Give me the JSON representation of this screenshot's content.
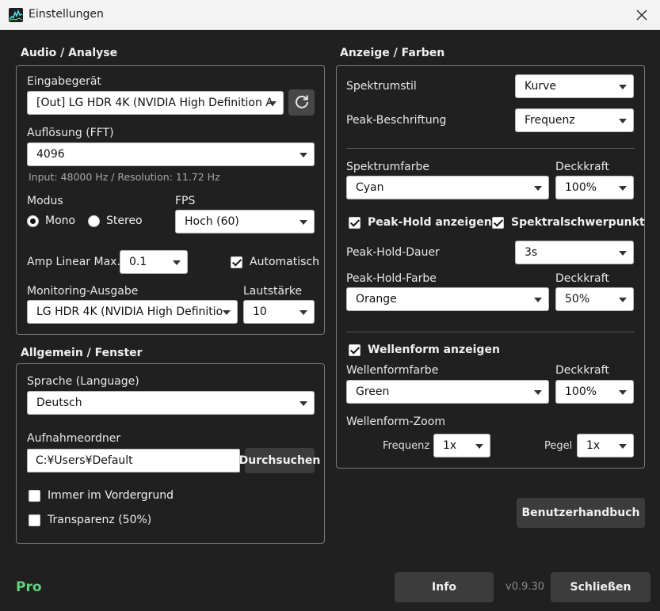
{
  "window": {
    "title": "Einstellungen",
    "icon": "spectrum-app-icon",
    "close_icon": "close-icon"
  },
  "audio": {
    "section_title": "Audio / Analyse",
    "input_device_label": "Eingabegerät",
    "input_device_value": "[Out] LG HDR 4K (NVIDIA High Definition A",
    "refresh_icon": "refresh-icon",
    "fft_label": "Auflösung (FFT)",
    "fft_value": "4096",
    "info_text": "Input: 48000 Hz / Resolution: 11.72 Hz",
    "mode_label": "Modus",
    "mode_mono": "Mono",
    "mode_stereo": "Stereo",
    "mode_selected": "Mono",
    "fps_label": "FPS",
    "fps_value": "Hoch (60)",
    "amp_label": "Amp Linear Max.",
    "amp_value": "0.1",
    "auto_label": "Automatisch",
    "auto_checked": true,
    "monitor_label": "Monitoring-Ausgabe",
    "monitor_value": "LG HDR 4K (NVIDIA High Definitio",
    "volume_label": "Lautstärke",
    "volume_value": "10"
  },
  "general": {
    "section_title": "Allgemein / Fenster",
    "language_label": "Sprache (Language)",
    "language_value": "Deutsch",
    "folder_label": "Aufnahmeordner",
    "folder_value": "C:¥Users¥Default",
    "browse_label": "Durchsuchen",
    "always_on_top_label": "Immer im Vordergrund",
    "always_on_top_checked": false,
    "transparency_label": "Transparenz (50%)",
    "transparency_checked": false
  },
  "display": {
    "section_title": "Anzeige / Farben",
    "spectrum_style_label": "Spektrumstil",
    "spectrum_style_value": "Kurve",
    "peak_label_label": "Peak-Beschriftung",
    "peak_label_value": "Frequenz",
    "spectrum_color_label": "Spektrumfarbe",
    "spectrum_color_value": "Cyan",
    "opacity_label": "Deckkraft",
    "spectrum_opacity_value": "100%",
    "peak_hold_label": "Peak-Hold anzeigen",
    "peak_hold_checked": true,
    "centroid_label": "Spektralschwerpunkt",
    "centroid_checked": true,
    "peak_hold_duration_label": "Peak-Hold-Dauer",
    "peak_hold_duration_value": "3s",
    "peak_hold_color_label": "Peak-Hold-Farbe",
    "peak_hold_color_value": "Orange",
    "peak_hold_opacity_value": "50%",
    "waveform_show_label": "Wellenform anzeigen",
    "waveform_show_checked": true,
    "waveform_color_label": "Wellenformfarbe",
    "waveform_color_value": "Green",
    "waveform_opacity_value": "100%",
    "waveform_zoom_label": "Wellenform-Zoom",
    "freq_label": "Frequenz",
    "freq_value": "1x",
    "level_label": "Pegel",
    "level_value": "1x"
  },
  "footer": {
    "manual_label": "Benutzerhandbuch",
    "pro_label": "Pro",
    "info_label": "Info",
    "version": "v0.9.30",
    "close_label": "Schließen"
  },
  "colors": {
    "background": "#202020",
    "pro_accent": "#5fd37a",
    "titlebar": "#f3f3f3"
  }
}
